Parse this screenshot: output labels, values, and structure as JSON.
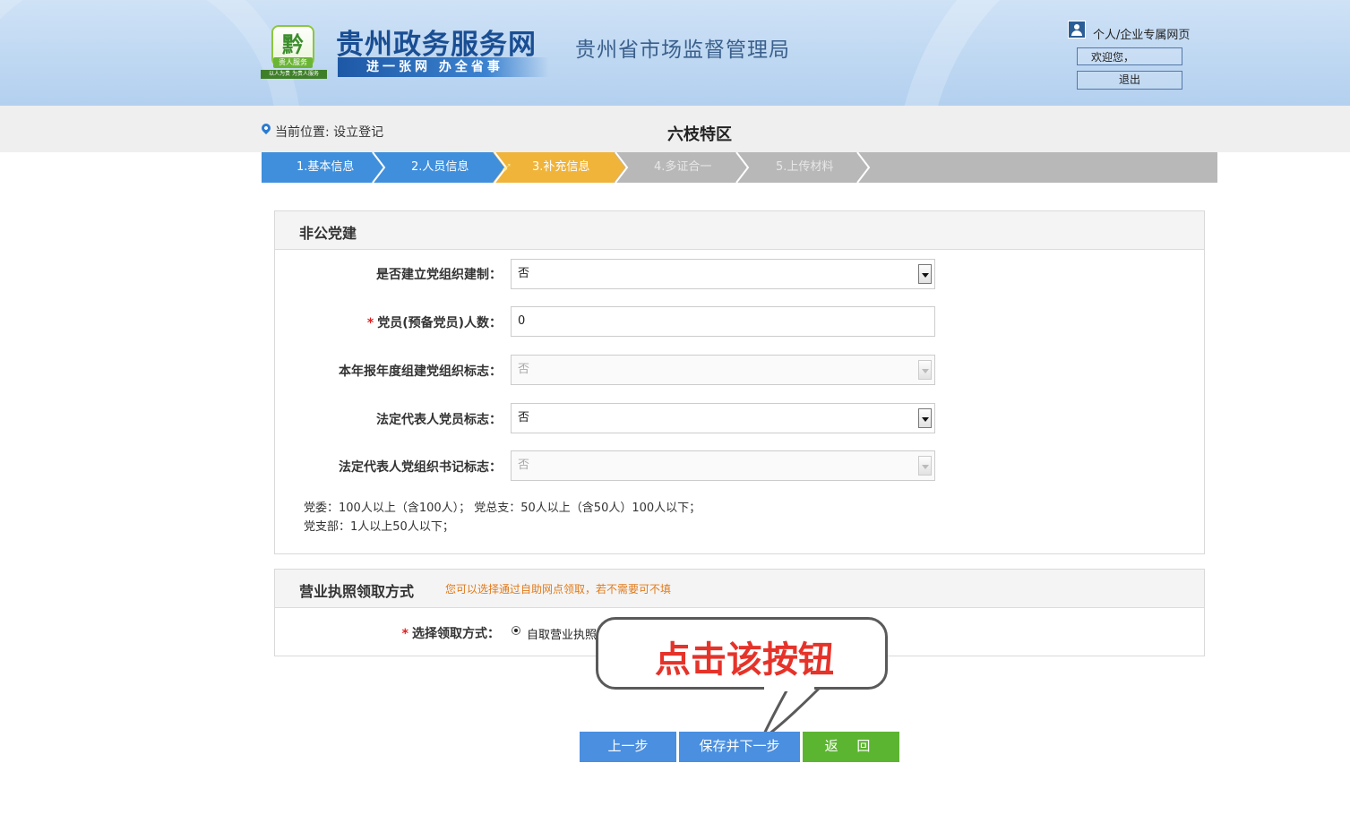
{
  "header": {
    "logo_glyph": "黔",
    "logo_tag": "贵人服务",
    "logo_sub": "以人为贵 为贵人服务",
    "site_title": "贵州政务服务网",
    "site_slogan": "进一张网 办全省事",
    "bureau": "贵州省市场监督管理局",
    "user_link": "个人/企业专属网页",
    "welcome": "欢迎您，",
    "logout": "退出"
  },
  "location": {
    "label": "当前位置: 设立登记",
    "region": "六枝特区"
  },
  "steps": [
    {
      "label": "1.基本信息",
      "state": "done"
    },
    {
      "label": "2.人员信息",
      "state": "done"
    },
    {
      "label": "3.补充信息",
      "state": "current"
    },
    {
      "label": "4.多证合一",
      "state": "todo"
    },
    {
      "label": "5.上传材料",
      "state": "todo"
    }
  ],
  "party_panel": {
    "title": "非公党建",
    "fields": {
      "has_org": {
        "label": "是否建立党组织建制：",
        "value": "否"
      },
      "members": {
        "label": "党员(预备党员)人数：",
        "value": "0",
        "required": "*"
      },
      "annual_flag": {
        "label": "本年报年度组建党组织标志：",
        "value": "否"
      },
      "rep_member": {
        "label": "法定代表人党员标志：",
        "value": "否"
      },
      "rep_secretary": {
        "label": "法定代表人党组织书记标志：",
        "value": "否"
      }
    },
    "note_line1": "党委：100人以上（含100人）；   党总支：50人以上（含50人）100人以下；",
    "note_line2": "党支部：1人以上50人以下；"
  },
  "license_panel": {
    "title": "营业执照领取方式",
    "hint": "您可以选择通过自助网点领取，若不需要可不填",
    "field_label": "选择领取方式：",
    "required": "*",
    "option": "自取营业执照"
  },
  "buttons": {
    "prev": "上一步",
    "save": "保存并下一步",
    "back": "返 回"
  },
  "callout": {
    "text": "点击该按钮"
  },
  "colors": {
    "step_done": "#3f8fdc",
    "step_current": "#f0b43a",
    "step_todo": "#b8b8b8",
    "button_blue": "#4a8fe0",
    "button_green": "#5cb531",
    "callout_text": "#e5332a"
  }
}
